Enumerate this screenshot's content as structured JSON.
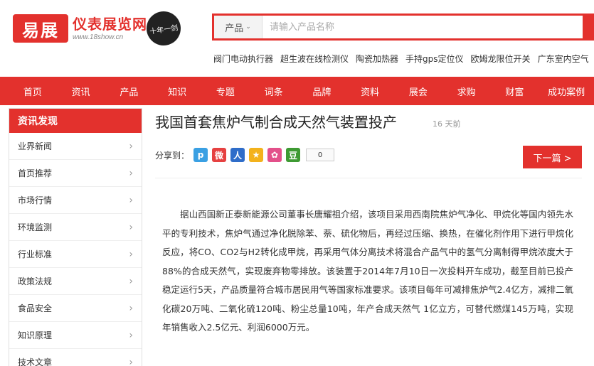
{
  "logo": {
    "mark": "易展",
    "name": "仪表展览网",
    "url": "www.18show.cn",
    "seal": "十年一剑"
  },
  "search": {
    "category": "产品",
    "placeholder": "请输入产品名称"
  },
  "hotwords": [
    "阀门电动执行器",
    "超生波在线检测仪",
    "陶瓷加热器",
    "手持gps定位仪",
    "欧姆龙限位开关",
    "广东室内空气"
  ],
  "nav": [
    "首页",
    "资讯",
    "产品",
    "知识",
    "专题",
    "词条",
    "品牌",
    "资料",
    "展会",
    "求购",
    "财富",
    "成功案例"
  ],
  "sidebar": {
    "title": "资讯发现",
    "items": [
      "业界新闻",
      "首页推荐",
      "市场行情",
      "环境监测",
      "行业标准",
      "政策法规",
      "食品安全",
      "知识原理",
      "技术文章"
    ]
  },
  "article": {
    "title": "我国首套焦炉气制合成天然气装置投产",
    "time": "16 天前",
    "share_label": "分享到：",
    "share_count": "0",
    "next_label": "下一篇 >",
    "body": "据山西国新正泰新能源公司董事长唐耀祖介绍，该项目采用西南院焦炉气净化、甲烷化等国内领先水平的专利技术，焦炉气通过净化脱除苯、萘、硫化物后，再经过压缩、换热，在催化剂作用下进行甲烷化反应，将CO、CO2与H2转化成甲烷，再采用气体分离技术将混合产品气中的氢气分离制得甲烷浓度大于88%的合成天然气，实现废弃物零排放。该装置于2014年7月10日一次投料开车成功，截至目前已投产稳定运行5天，产品质量符合城市居民用气等国家标准要求。该项目每年可减排焦炉气2.4亿方，减排二氧化碳20万吨、二氧化硫120吨、粉尘总量10吨，年产合成天然气 1亿立方，可替代燃煤145万吨，实现年销售收入2.5亿元、利润6000万元。"
  },
  "share_icons": [
    {
      "name": "pinterest-share-icon",
      "glyph": "p",
      "color": "#3aa0e3"
    },
    {
      "name": "weibo-share-icon",
      "glyph": "微",
      "color": "#e64141"
    },
    {
      "name": "renren-share-icon",
      "glyph": "人",
      "color": "#2f6dc9"
    },
    {
      "name": "qzone-share-icon",
      "glyph": "★",
      "color": "#f3b21c"
    },
    {
      "name": "tencent-weibo-share-icon",
      "glyph": "✿",
      "color": "#e3508a"
    },
    {
      "name": "douban-share-icon",
      "glyph": "豆",
      "color": "#3e9a33"
    }
  ],
  "colors": {
    "brand": "#e3312d"
  }
}
